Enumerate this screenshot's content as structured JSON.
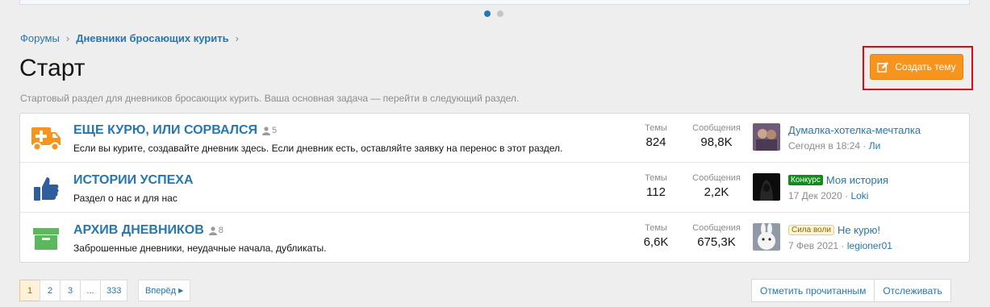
{
  "breadcrumb": {
    "root": "Форумы",
    "current": "Дневники бросающих курить"
  },
  "page": {
    "title": "Старт",
    "description": "Стартовый раздел для дневников бросающих курить. Ваша основная задача — перейти в следующий раздел."
  },
  "create_button": {
    "label": "Создать тему",
    "color": "#f7941e"
  },
  "stats_labels": {
    "themes": "Темы",
    "messages": "Сообщения"
  },
  "nodes": [
    {
      "title": "ЕЩЕ КУРЮ, ИЛИ СОРВАЛСЯ",
      "viewers": "5",
      "description": "Если вы курите, создавайте дневник здесь. Если дневник есть, оставляйте заявку на перенос в этот раздел.",
      "themes": "824",
      "messages": "98,8K",
      "last_title": "Думалка-хотелка-мечталка",
      "last_date": "Сегодня в 18:24",
      "last_user": "Ли",
      "icon": "ambulance-icon"
    },
    {
      "title": "ИСТОРИИ УСПЕХА",
      "description": "Раздел о нас и для нас",
      "themes": "112",
      "messages": "2,2K",
      "last_prefix": "Конкурс",
      "last_title": "Моя история",
      "last_date": "17 Дек 2020",
      "last_user": "Loki",
      "icon": "thumbs-up-icon"
    },
    {
      "title": "АРХИВ ДНЕВНИКОВ",
      "viewers": "8",
      "description": "Заброшенные дневники, неудачные начала, дубликаты.",
      "themes": "6,6K",
      "messages": "675,3K",
      "last_prefix": "Сила воли",
      "last_title": "Не курю!",
      "last_date": "7 Фев 2021",
      "last_user": "legioner01",
      "icon": "archive-icon"
    }
  ],
  "pagination": {
    "pages": [
      "1",
      "2",
      "3",
      "...",
      "333"
    ],
    "next": "Вперёд"
  },
  "actions": {
    "mark_read": "Отметить прочитанным",
    "watch": "Отслеживать"
  },
  "colors": {
    "link": "#2577b1",
    "orange": "#f7941e",
    "blue_icon": "#2f5e9c",
    "green_icon": "#5cb85c"
  }
}
